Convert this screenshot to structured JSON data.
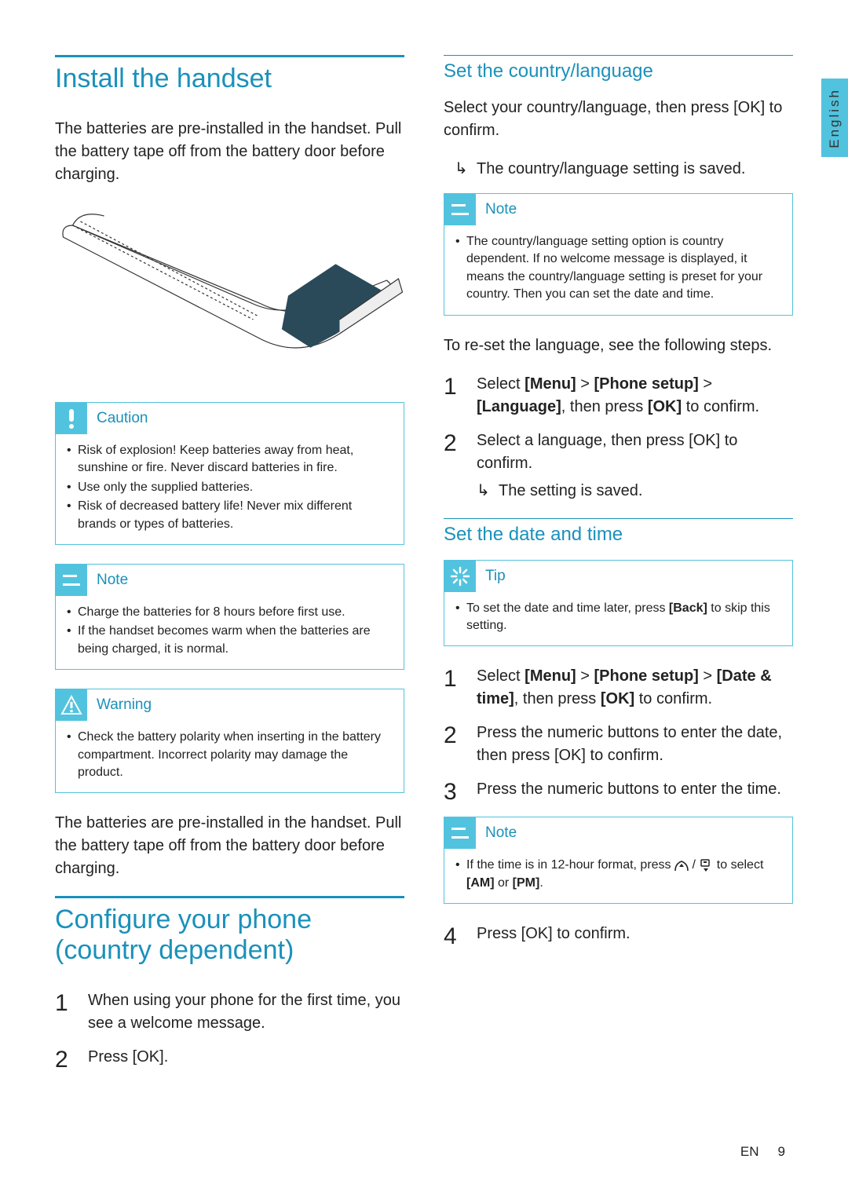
{
  "sideTab": "English",
  "leftCol": {
    "h1": "Install the handset",
    "intro": "The batteries are pre-installed in the handset. Pull the battery tape off from the battery door before charging.",
    "caution": {
      "title": "Caution",
      "items": [
        "Risk of explosion! Keep batteries away from heat, sunshine or fire. Never discard batteries in fire.",
        "Use only the supplied batteries.",
        "Risk of decreased battery life! Never mix different brands or types of batteries."
      ]
    },
    "note": {
      "title": "Note",
      "items": [
        "Charge the batteries for 8 hours before first use.",
        "If the handset becomes warm when the batteries are being charged, it is normal."
      ]
    },
    "warning": {
      "title": "Warning",
      "items": [
        "Check the battery polarity when inserting in the battery compartment. Incorrect polarity may damage the product."
      ]
    },
    "intro2": "The batteries are pre-installed in the handset. Pull the battery tape off from the battery door before charging.",
    "h1b": "Configure your phone (country dependent)",
    "steps1": [
      "When using your phone for the first time, you see a welcome message.",
      "Press [OK]."
    ]
  },
  "rightCol": {
    "h2a": "Set the country/language",
    "paraA": "Select your country/language, then press [OK] to confirm.",
    "resultA": "The country/language setting is saved.",
    "noteA": {
      "title": "Note",
      "items": [
        "The country/language setting option is country dependent. If no welcome message is displayed, it means the country/language setting is preset for your country. Then you can set the date and time."
      ]
    },
    "paraB": "To re-set the language, see the following steps.",
    "langStep1a": "Select ",
    "langStep1b": "[Menu]",
    "langStep1c": " > ",
    "langStep1d": "[Phone setup]",
    "langStep1e": " > ",
    "langStep1f": "[Language]",
    "langStep1g": ", then press ",
    "langStep1h": "[OK]",
    "langStep1i": " to confirm.",
    "langStep2": "Select a language, then press [OK] to confirm.",
    "langResult": "The setting is saved.",
    "h2b": "Set the date and time",
    "tip": {
      "title": "Tip",
      "item1a": "To set the date and time later, press ",
      "item1b": "[Back]",
      "item1c": " to skip this setting."
    },
    "dtStep1a": "Select ",
    "dtStep1b": "[Menu]",
    "dtStep1c": " > ",
    "dtStep1d": "[Phone setup]",
    "dtStep1e": " > ",
    "dtStep1f": "[Date & time]",
    "dtStep1g": ", then press ",
    "dtStep1h": "[OK]",
    "dtStep1i": " to confirm.",
    "dtStep2": "Press the numeric buttons to enter the date, then press [OK] to confirm.",
    "dtStep3": "Press the numeric buttons to enter the time.",
    "noteB": {
      "title": "Note",
      "item1a": "If the time is in 12-hour format, press ",
      "item1b": " / ",
      "item1c": " to select ",
      "item1d": "[AM]",
      "item1e": " or ",
      "item1f": "[PM]",
      "item1g": "."
    },
    "dtStep4": "Press [OK] to confirm."
  },
  "footer": {
    "lang": "EN",
    "page": "9"
  }
}
